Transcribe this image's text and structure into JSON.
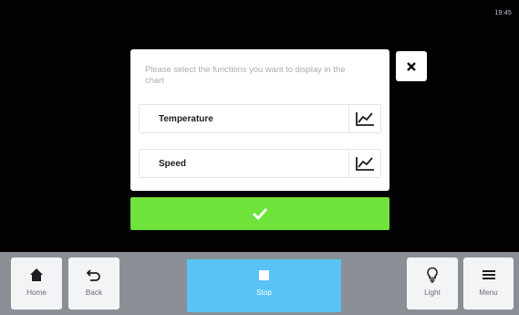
{
  "status_bar": {
    "time": "19:45"
  },
  "dialog": {
    "title": "Please select the functions you want to display in the chart",
    "options": [
      {
        "label": "Temperature",
        "icon": "line-chart-icon"
      },
      {
        "label": "Speed",
        "icon": "line-chart-icon"
      }
    ],
    "close_icon": "close-icon",
    "confirm_icon": "checkmark-icon"
  },
  "bottom_bar": {
    "home_label": "Home",
    "back_label": "Back",
    "stop_label": "Stop",
    "light_label": "Light",
    "menu_label": "Menu"
  },
  "colors": {
    "confirm": "#6fe33a",
    "stop": "#5ac3f6",
    "bottom_bar": "#8a8f96"
  }
}
